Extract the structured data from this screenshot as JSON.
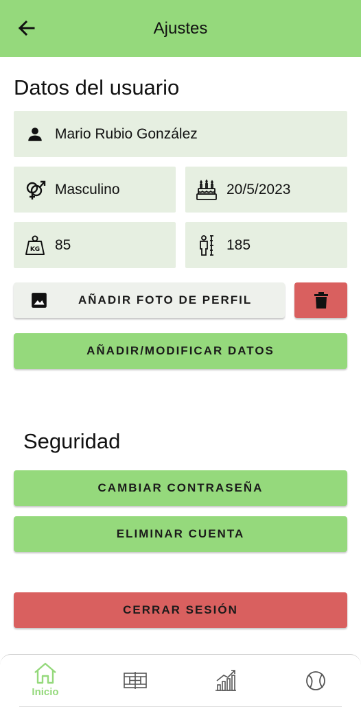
{
  "appbar": {
    "title": "Ajustes",
    "back_icon": "arrow-left-icon"
  },
  "user_section": {
    "title": "Datos del usuario",
    "name": "Mario Rubio González",
    "gender": "Masculino",
    "birthdate": "20/5/2023",
    "weight": "85",
    "height": "185"
  },
  "buttons": {
    "add_photo": "AÑADIR FOTO DE PERFIL",
    "modify_data": "AÑADIR/MODIFICAR DATOS",
    "change_password": "CAMBIAR CONTRASEÑA",
    "delete_account": "ELIMINAR CUENTA",
    "logout": "CERRAR SESIÓN"
  },
  "security_section": {
    "title": "Seguridad"
  },
  "bottom_nav": {
    "items": [
      {
        "label": "Inicio",
        "icon": "home-icon",
        "active": true
      },
      {
        "label": "",
        "icon": "court-icon",
        "active": false
      },
      {
        "label": "",
        "icon": "stats-chart-icon",
        "active": false
      },
      {
        "label": "",
        "icon": "ball-icon",
        "active": false
      }
    ]
  },
  "colors": {
    "primary": "#95d97c",
    "danger": "#d9605f",
    "field_bg": "#e6efe1",
    "light_button": "#eef1ec"
  }
}
